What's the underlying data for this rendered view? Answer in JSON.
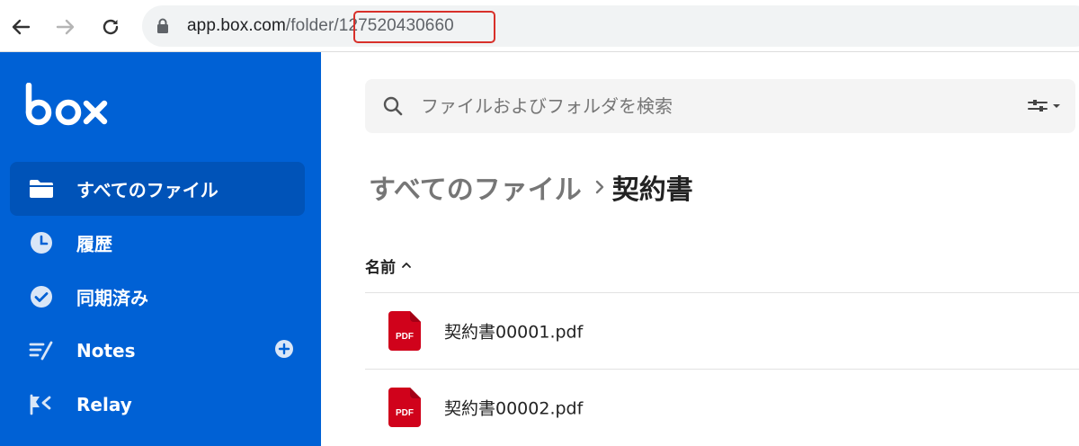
{
  "browser": {
    "url_host": "app.box.com",
    "url_path_prefix": "/folder",
    "url_folder_id": "/127520430660"
  },
  "sidebar": {
    "logo_text": "box",
    "items": [
      {
        "label": "すべてのファイル",
        "icon": "folder-icon",
        "active": true
      },
      {
        "label": "履歴",
        "icon": "clock-icon",
        "active": false
      },
      {
        "label": "同期済み",
        "icon": "check-circle-icon",
        "active": false
      },
      {
        "label": "Notes",
        "icon": "notes-icon",
        "active": false
      },
      {
        "label": "Relay",
        "icon": "relay-icon",
        "active": false
      }
    ]
  },
  "search": {
    "placeholder": "ファイルおよびフォルダを検索"
  },
  "breadcrumb": {
    "root": "すべてのファイル",
    "current": "契約書"
  },
  "list": {
    "column_name": "名前",
    "files": [
      {
        "name": "契約書00001.pdf",
        "type": "PDF"
      },
      {
        "name": "契約書00002.pdf",
        "type": "PDF"
      }
    ]
  },
  "colors": {
    "sidebar_bg": "#0061d5",
    "sidebar_active": "#0053b8",
    "pdf_red": "#d0021b",
    "highlight_red": "#d8302a"
  }
}
